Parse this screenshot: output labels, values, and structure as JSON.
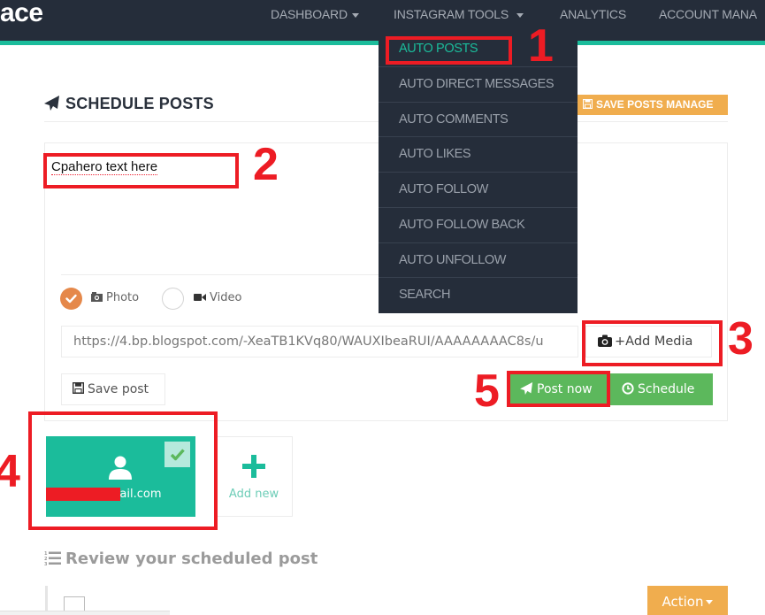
{
  "navbar": {
    "brand": "ace",
    "items": [
      {
        "label": "DASHBOARD",
        "has_caret": true
      },
      {
        "label": "INSTAGRAM TOOLS",
        "has_caret": true
      },
      {
        "label": "ANALYTICS",
        "has_caret": false
      },
      {
        "label": "ACCOUNT MANA",
        "has_caret": false
      }
    ]
  },
  "dropdown": {
    "items": [
      {
        "label": "AUTO POSTS",
        "active": true
      },
      {
        "label": "AUTO DIRECT MESSAGES",
        "active": false
      },
      {
        "label": "AUTO COMMENTS",
        "active": false
      },
      {
        "label": "AUTO LIKES",
        "active": false
      },
      {
        "label": "AUTO FOLLOW",
        "active": false
      },
      {
        "label": "AUTO FOLLOW BACK",
        "active": false
      },
      {
        "label": "AUTO UNFOLLOW",
        "active": false
      },
      {
        "label": "SEARCH",
        "active": false
      }
    ]
  },
  "header": {
    "title": "SCHEDULE POSTS",
    "save_manage_label": "SAVE POSTS MANAGE"
  },
  "composer": {
    "caption_text": "Cpahero text here",
    "media_types": [
      {
        "label": "Photo",
        "selected": true,
        "icon": "camera-icon"
      },
      {
        "label": "Video",
        "selected": false,
        "icon": "video-camera-icon"
      }
    ],
    "media_url": "https://4.bp.blogspot.com/-XeaTB1KVq80/WAUXIbeaRUI/AAAAAAAAC8s/u",
    "add_media_label": "+Add Media",
    "save_post_label": "Save post",
    "post_now_label": "Post now",
    "schedule_label": "Schedule"
  },
  "accounts": {
    "items": [
      {
        "email_suffix": "gmail.com",
        "selected": true
      }
    ],
    "add_new_label": "Add new"
  },
  "review": {
    "title": "Review your scheduled post",
    "action_label": "Action"
  },
  "annotations": [
    "1",
    "2",
    "3",
    "4",
    "5"
  ],
  "colors": {
    "navbar_bg": "#252d3a",
    "accent_teal": "#1bbc9b",
    "warning_orange": "#f0ad4e",
    "success_green": "#5cb85c",
    "radio_orange": "#e5884a",
    "annotation_red": "#ed1c24"
  }
}
